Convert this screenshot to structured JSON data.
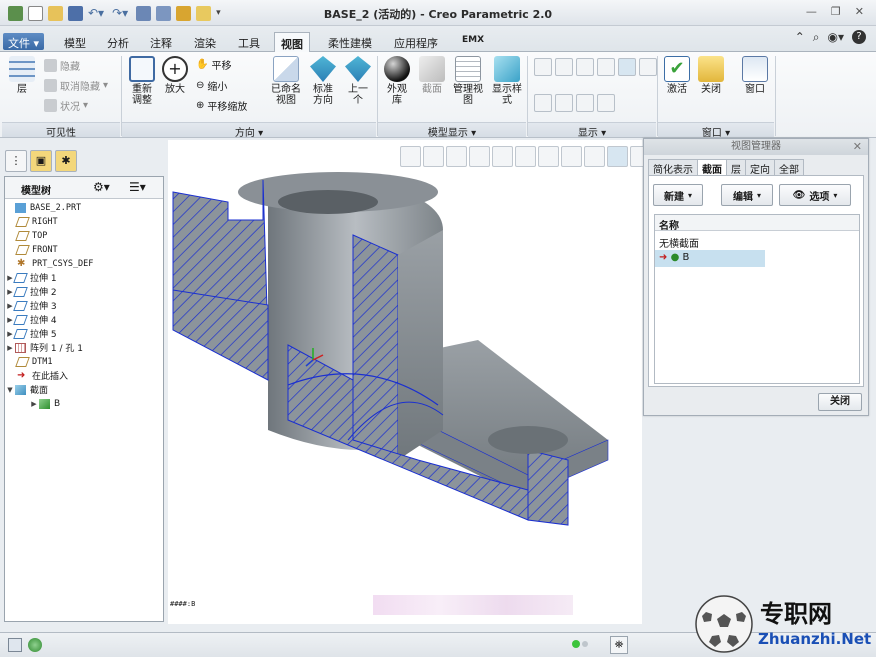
{
  "window": {
    "title": "BASE_2 (活动的) - Creo Parametric 2.0"
  },
  "ribbon": {
    "tabs": [
      "文件",
      "模型",
      "分析",
      "注释",
      "渲染",
      "工具",
      "视图",
      "柔性建模",
      "应用程序",
      "EMX"
    ],
    "active_tab": "视图",
    "groups": {
      "visibility": {
        "label": "可见性",
        "layer": "层",
        "hide": "隐藏",
        "unhide": "取消隐藏",
        "status": "状况"
      },
      "orientation": {
        "label": "方向",
        "refit": "重新调整",
        "zoom_in": "放大",
        "pan": "平移",
        "zoom_out": "缩小",
        "pan_zoom": "平移缩放",
        "named_views": "已命名视图",
        "standard": "标准方向",
        "previous": "上一个"
      },
      "model_display": {
        "label": "模型显示",
        "appearance": "外观库",
        "section": "截面",
        "manage_views": "管理视图",
        "display_style": "显示样式"
      },
      "show": {
        "label": "显示"
      },
      "window": {
        "label": "窗口",
        "activate": "激活",
        "close": "关闭",
        "windows": "窗口"
      }
    }
  },
  "model_tree": {
    "title": "模型树",
    "items": [
      {
        "label": "BASE_2.PRT"
      },
      {
        "label": "RIGHT"
      },
      {
        "label": "TOP"
      },
      {
        "label": "FRONT"
      },
      {
        "label": "PRT_CSYS_DEF"
      },
      {
        "label": "拉伸 1"
      },
      {
        "label": "拉伸 2"
      },
      {
        "label": "拉伸 3"
      },
      {
        "label": "拉伸 4"
      },
      {
        "label": "拉伸 5"
      },
      {
        "label": "阵列 1 / 孔 1"
      },
      {
        "label": "DTM1"
      },
      {
        "label": "在此插入"
      },
      {
        "label": "截面"
      },
      {
        "label": "B"
      }
    ]
  },
  "viewport": {
    "view_label": "####:B"
  },
  "view_manager": {
    "title": "视图管理器",
    "tabs": [
      "简化表示",
      "截面",
      "层",
      "定向",
      "全部"
    ],
    "active_tab": "截面",
    "new_btn": "新建",
    "edit_btn": "编辑",
    "options_btn": "选项",
    "column": "名称",
    "rows": [
      "无横截面",
      "B"
    ],
    "close_btn": "关闭"
  },
  "watermark": {
    "text_cn": "专职网",
    "text_url": "Zhuanzhi.Net"
  },
  "colors": {
    "accent": "#3a6aa6",
    "hatch": "#1a2fd0",
    "model": "#8a9096",
    "selection": "#c7e0ef"
  }
}
